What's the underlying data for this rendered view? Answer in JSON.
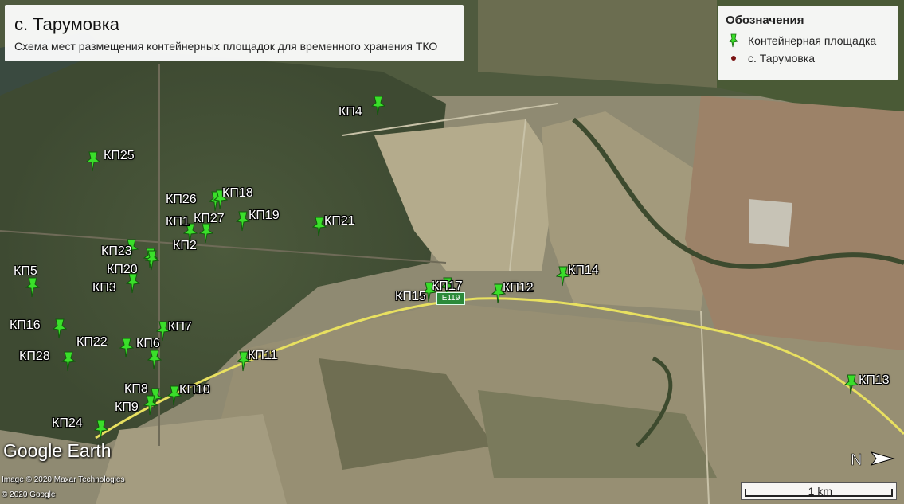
{
  "title": "с. Тарумовка",
  "subtitle": "Схема мест размещения контейнерных площадок для временного хранения ТКО",
  "legend": {
    "heading": "Обозначения",
    "items": [
      {
        "label": "Контейнерная площадка",
        "icon": "green-pushpin-icon"
      },
      {
        "label": "с. Тарумовка",
        "icon": "dark-red-dot-icon"
      }
    ]
  },
  "placemarks": [
    "КП4",
    "КП25",
    "КП26",
    "КП18",
    "КП1",
    "КП27",
    "КП19",
    "КП21",
    "КП2",
    "КП23",
    "КП20",
    "КП5",
    "КП3",
    "КП17",
    "КП15",
    "КП12",
    "КП14",
    "КП16",
    "КП7",
    "КП22",
    "КП6",
    "КП28",
    "КП11",
    "КП8",
    "КП10",
    "КП9",
    "КП24",
    "КП13"
  ],
  "road_label": "Е119",
  "branding": "Google Earth",
  "imagery_credit": "Image © 2020 Maxar Technologies",
  "copyright": "© 2020 Google",
  "scale_label": "1 km",
  "north_label": "N",
  "colors": {
    "pin": "#3adf2a",
    "road": "#e8e060",
    "panel": "#ffffff"
  }
}
